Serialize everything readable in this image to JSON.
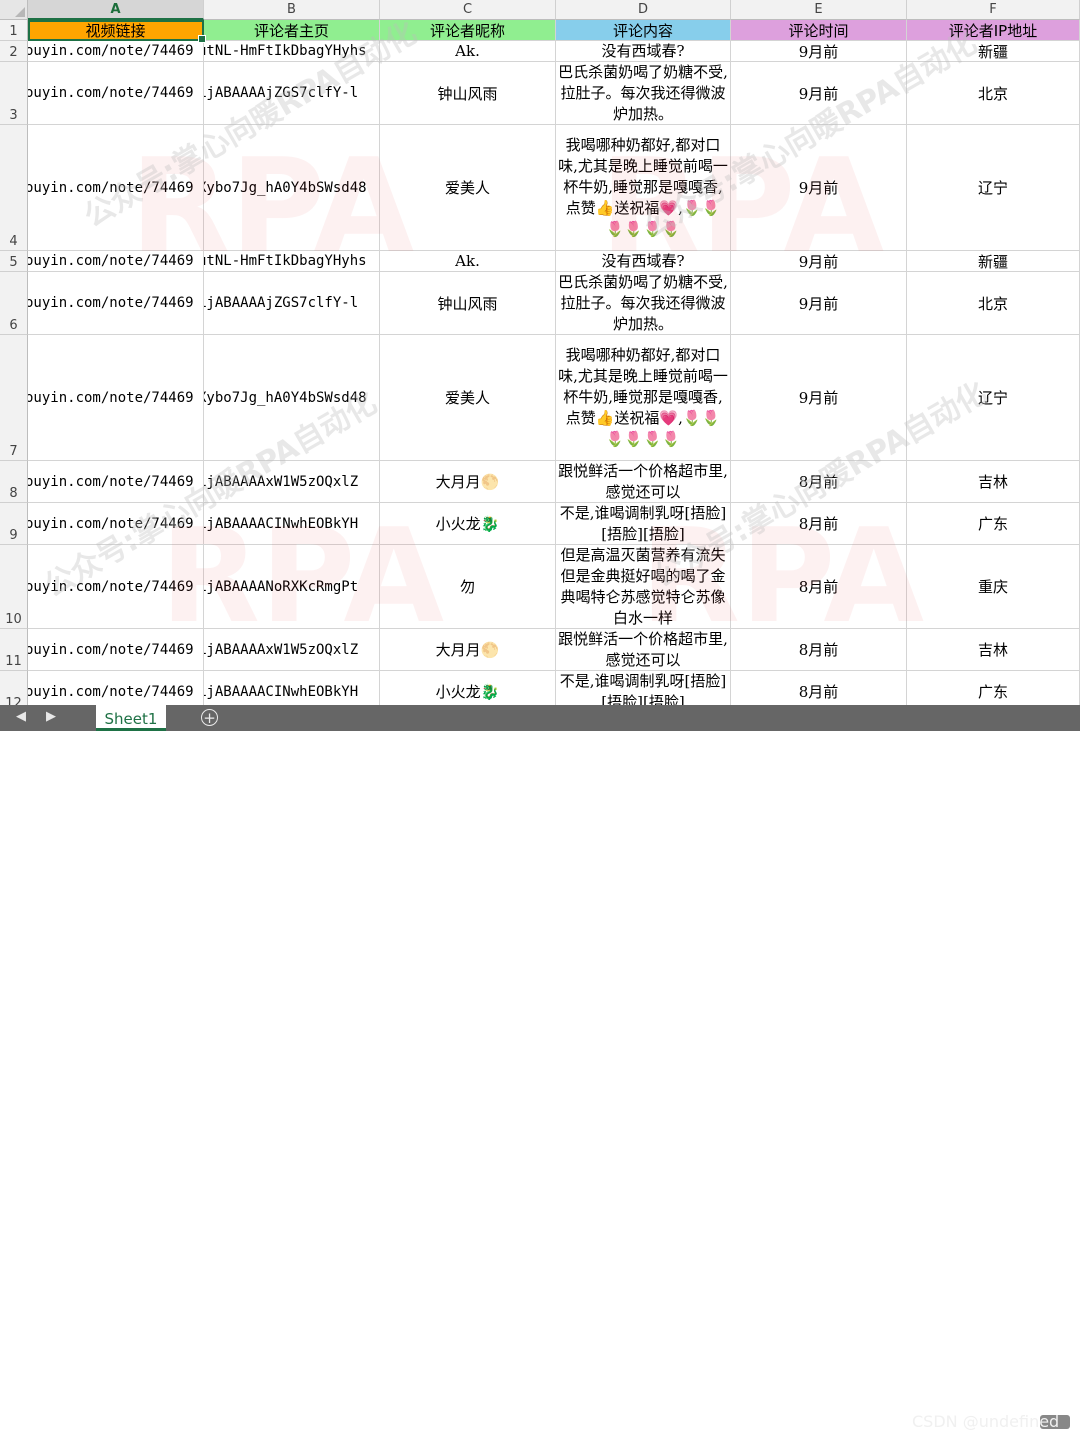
{
  "sheet": {
    "columns": [
      "A",
      "B",
      "C",
      "D",
      "E",
      "F"
    ],
    "header_row": {
      "row_number": "1",
      "cells": [
        "视频链接",
        "评论者主页",
        "评论者昵称",
        "评论内容",
        "评论时间",
        "评论者IP地址"
      ],
      "colors": [
        "#ffa500",
        "#90ee90",
        "#90ee90",
        "#87ceeb",
        "#dda0dd",
        "#dda0dd"
      ]
    },
    "rows": [
      {
        "row": "2",
        "a": "ouyin.com/note/74469",
        "b": "utNL-HmFtIkDbagYHyhs",
        "c": "Ak.",
        "d": "没有西域春?",
        "e": "9月前",
        "f": "新疆"
      },
      {
        "row": "3",
        "a": "ouyin.com/note/74469",
        "b": "LjABAAAAjZGS7clfY-l",
        "c": "钟山风雨",
        "d": "巴氏杀菌奶喝了奶糖不受,拉肚子。每次我还得微波炉加热。",
        "e": "9月前",
        "f": "北京"
      },
      {
        "row": "4",
        "a": "ouyin.com/note/74469",
        "b": "Xybo7Jg_hA0Y4bSWsd48",
        "c": "爱美人",
        "d": "我喝哪种奶都好,都对口味,尤其是晚上睡觉前喝一杯牛奶,睡觉那是嘎嘎香,点赞👍送祝福💗,🌷🌷🌷🌷🌷🌷",
        "e": "9月前",
        "f": "辽宁"
      },
      {
        "row": "5",
        "a": "ouyin.com/note/74469",
        "b": "utNL-HmFtIkDbagYHyhs",
        "c": "Ak.",
        "d": "没有西域春?",
        "e": "9月前",
        "f": "新疆"
      },
      {
        "row": "6",
        "a": "ouyin.com/note/74469",
        "b": "LjABAAAAjZGS7clfY-l",
        "c": "钟山风雨",
        "d": "巴氏杀菌奶喝了奶糖不受,拉肚子。每次我还得微波炉加热。",
        "e": "9月前",
        "f": "北京"
      },
      {
        "row": "7",
        "a": "ouyin.com/note/74469",
        "b": "Xybo7Jg_hA0Y4bSWsd48",
        "c": "爱美人",
        "d": "我喝哪种奶都好,都对口味,尤其是晚上睡觉前喝一杯牛奶,睡觉那是嘎嘎香,点赞👍送祝福💗,🌷🌷🌷🌷🌷🌷",
        "e": "9月前",
        "f": "辽宁"
      },
      {
        "row": "8",
        "a": "ouyin.com/note/74469",
        "b": "LjABAAAAxW1W5zOQxlZ",
        "c": "大月月🌕",
        "d": "跟悦鲜活一个价格超市里,感觉还可以",
        "e": "8月前",
        "f": "吉林"
      },
      {
        "row": "9",
        "a": "ouyin.com/note/74469",
        "b": "LjABAAAACINwhEOBkYH",
        "c": "小火龙🐉",
        "d": "不是,谁喝调制乳呀[捂脸][捂脸][捂脸]",
        "e": "8月前",
        "f": "广东"
      },
      {
        "row": "10",
        "a": "ouyin.com/note/74469",
        "b": "LjABAAAANoRXKcRmgPt",
        "c": "勿",
        "d": "但是高温灭菌营养有流失但是金典挺好喝的喝了金典喝特仑苏感觉特仑苏像白水一样",
        "e": "8月前",
        "f": "重庆"
      },
      {
        "row": "11",
        "a": "ouyin.com/note/74469",
        "b": "LjABAAAAxW1W5zOQxlZ",
        "c": "大月月🌕",
        "d": "跟悦鲜活一个价格超市里,感觉还可以",
        "e": "8月前",
        "f": "吉林"
      },
      {
        "row": "12",
        "a": "ouyin.com/note/74469",
        "b": "LjABAAAACINwhEOBkYH",
        "c": "小火龙🐉",
        "d": "不是,谁喝调制乳呀[捂脸][捂脸][捂脸]",
        "e": "8月前",
        "f": "广东"
      }
    ]
  },
  "watermark": {
    "big": "RPA",
    "small": "公众号:掌心向暖RPA自动化"
  },
  "tabs": {
    "sheet_name": "Sheet1",
    "prev": "◀",
    "next": "▶",
    "add": "+"
  },
  "credit": "CSDN @undefined"
}
